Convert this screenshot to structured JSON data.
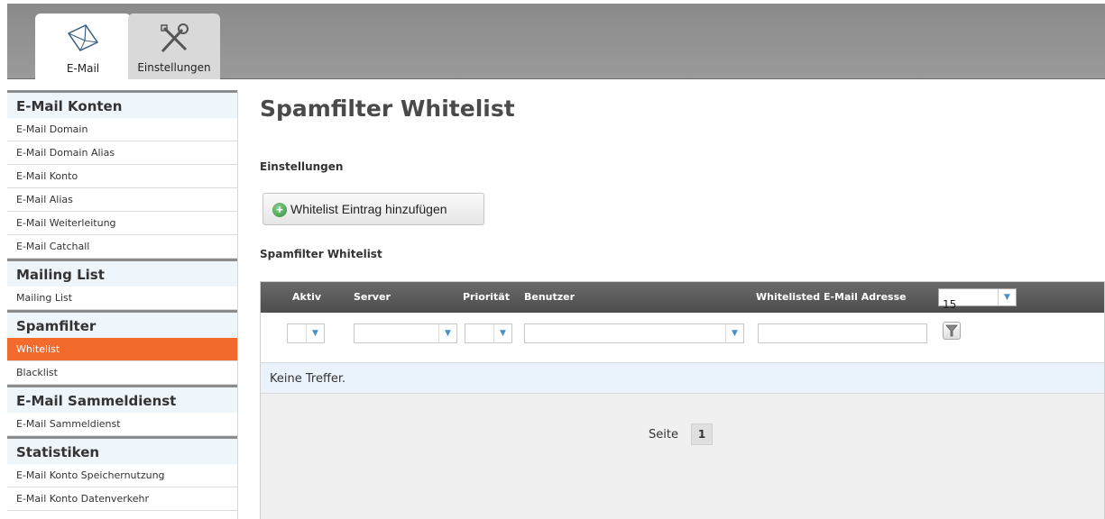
{
  "tabs": [
    {
      "label": "E-Mail",
      "icon": "envelope-icon"
    },
    {
      "label": "Einstellungen",
      "icon": "tools-icon"
    }
  ],
  "sidebar": {
    "sections": [
      {
        "heading": "E-Mail Konten",
        "items": [
          "E-Mail Domain",
          "E-Mail Domain Alias",
          "E-Mail Konto",
          "E-Mail Alias",
          "E-Mail Weiterleitung",
          "E-Mail Catchall"
        ]
      },
      {
        "heading": "Mailing List",
        "items": [
          "Mailing List"
        ]
      },
      {
        "heading": "Spamfilter",
        "items": [
          "Whitelist",
          "Blacklist"
        ]
      },
      {
        "heading": "E-Mail Sammeldienst",
        "items": [
          "E-Mail Sammeldienst"
        ]
      },
      {
        "heading": "Statistiken",
        "items": [
          "E-Mail Konto Speichernutzung",
          "E-Mail Konto Datenverkehr"
        ]
      }
    ],
    "active_item": "Whitelist",
    "active_color": "#f26a2c"
  },
  "main": {
    "title": "Spamfilter Whitelist",
    "settings_heading": "Einstellungen",
    "add_button": "Whitelist Eintrag hinzufügen",
    "list_heading": "Spamfilter Whitelist",
    "columns": [
      "Aktiv",
      "Server",
      "Priorität",
      "Benutzer",
      "Whitelisted E-Mail Adresse"
    ],
    "page_size": "15",
    "empty_text": "Keine Treffer.",
    "pager_label": "Seite",
    "current_page": "1"
  }
}
